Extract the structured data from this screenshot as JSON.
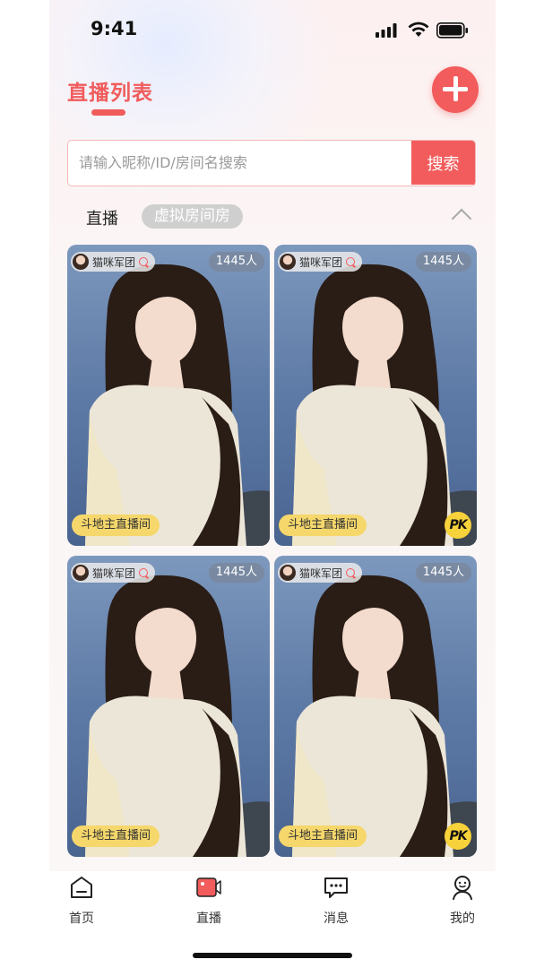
{
  "status_bar": {
    "time": "9:41"
  },
  "header": {
    "title": "直播列表"
  },
  "search": {
    "placeholder": "请输入昵称/ID/房间名搜索",
    "button_label": "搜索"
  },
  "tabs": {
    "live": "直播",
    "virtual": "虚拟房间房"
  },
  "cards": [
    {
      "host_name": "猫咪军团",
      "viewers": "1445人",
      "game_tag": "斗地主直播间",
      "pk": ""
    },
    {
      "host_name": "猫咪军团",
      "viewers": "1445人",
      "game_tag": "斗地主直播间",
      "pk": "PK"
    },
    {
      "host_name": "猫咪军团",
      "viewers": "1445人",
      "game_tag": "斗地主直播间",
      "pk": ""
    },
    {
      "host_name": "猫咪军团",
      "viewers": "1445人",
      "game_tag": "斗地主直播间",
      "pk": "PK"
    }
  ],
  "tabbar": {
    "home": "首页",
    "live": "直播",
    "messages": "消息",
    "mine": "我的"
  },
  "colors": {
    "accent": "#f25c5c",
    "tag_yellow": "#f5d76b",
    "pk_yellow": "#f7d23b"
  }
}
